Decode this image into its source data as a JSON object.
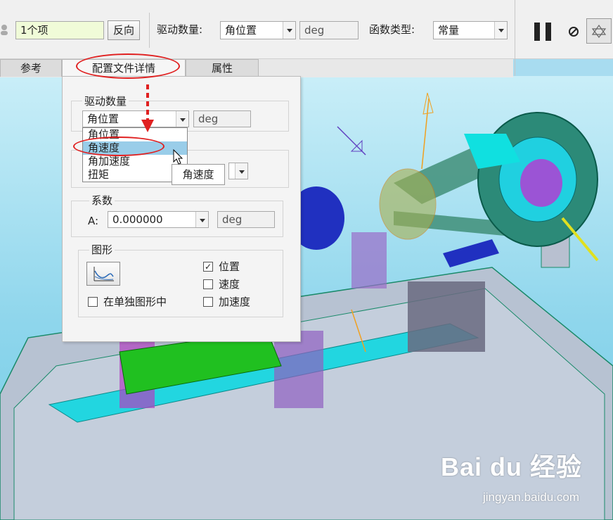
{
  "toolbar": {
    "collector_value": "1个项",
    "reverse_label": "反向",
    "driven_quantity_label": "驱动数量:",
    "driven_quantity_value": "角位置",
    "unit_value": "deg",
    "function_type_label": "函数类型:",
    "function_type_value": "常量"
  },
  "tabs": [
    "参考",
    "配置文件详情",
    "属性"
  ],
  "panel": {
    "driven_quantity_title": "驱动数量",
    "driven_quantity_value": "角位置",
    "unit_value": "deg",
    "dropdown_options": [
      "角位置",
      "角速度",
      "角加速度",
      "扭矩"
    ],
    "highlighted_option": "角速度",
    "tooltip": "角速度",
    "coefficient_title": "系数",
    "coef_a_label": "A:",
    "coef_a_value": "0.000000",
    "coef_unit": "deg",
    "graph_title": "图形",
    "separate_graph_label": "在单独图形中",
    "position_label": "位置",
    "velocity_label": "速度",
    "acceleration_label": "加速度",
    "position_checked": true,
    "velocity_checked": false,
    "acceleration_checked": false,
    "separate_graph_checked": false
  },
  "icons": {
    "pause": "pause-icon",
    "stop": "stop-icon",
    "preview": "preview-icon",
    "graph": "graph-icon",
    "pointer": "mouse-cursor-icon"
  },
  "watermark": {
    "brand": "Bai du 经验",
    "url": "jingyan.baidu.com"
  },
  "colors": {
    "annotation": "#e02020",
    "highlight": "#99cde9",
    "viewport_bg": "#8fd6ec"
  }
}
